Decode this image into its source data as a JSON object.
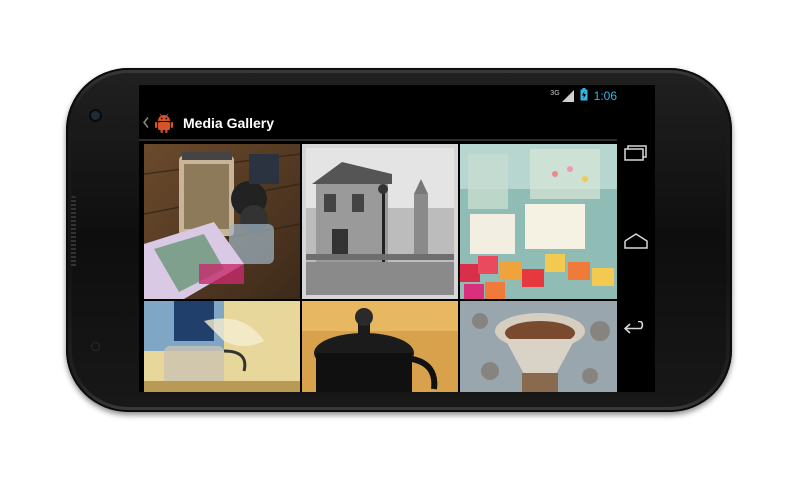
{
  "status_bar": {
    "network": "3G",
    "time": "1:06"
  },
  "action_bar": {
    "title": "Media Gallery",
    "up_icon": "chevron-left-icon",
    "app_icon": "android-robot-icon"
  },
  "gallery": {
    "items": [
      {
        "label": "coffee press and beans on wooden table"
      },
      {
        "label": "black and white victorian house"
      },
      {
        "label": "candies and signs on blue table"
      },
      {
        "label": "coffee kettle pouring into cup"
      },
      {
        "label": "black coffee press lid"
      },
      {
        "label": "pour-over coffee filter"
      }
    ]
  },
  "navigation": {
    "recent_apps_icon": "recent-apps-icon",
    "home_icon": "home-icon",
    "back_icon": "back-icon"
  },
  "colors": {
    "accent": "#33b5e5",
    "android_icon": "#d4532b"
  }
}
